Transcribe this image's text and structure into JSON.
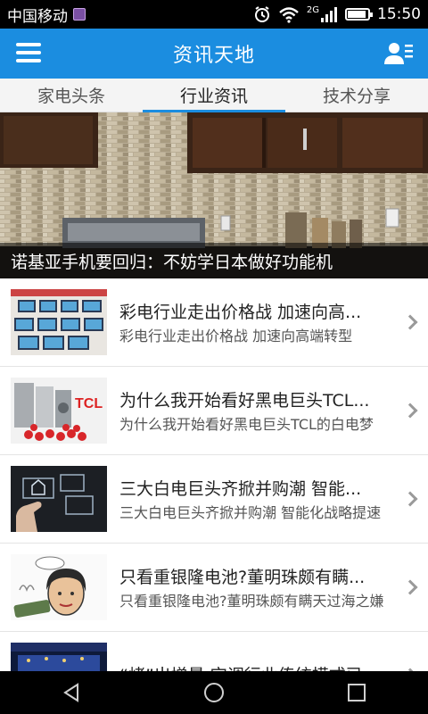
{
  "status_bar": {
    "carrier": "中国移动",
    "network": "2G",
    "time": "15:50",
    "battery_level": 0.9
  },
  "app_bar": {
    "title": "资讯天地",
    "left_icon": "menu-icon",
    "right_icon": "user-list-icon"
  },
  "tabs": [
    {
      "label": "家电头条",
      "active": false
    },
    {
      "label": "行业资讯",
      "active": true
    },
    {
      "label": "技术分享",
      "active": false
    }
  ],
  "banner": {
    "caption": "诺基亚手机要回归：不妨学日本做好功能机"
  },
  "news": [
    {
      "headline": "彩电行业走出价格战 加速向高...",
      "summary": "彩电行业走出价格战 加速向高端转型"
    },
    {
      "headline": "为什么我开始看好黑电巨头TCL...",
      "summary": "为什么我开始看好黑电巨头TCL的白电梦"
    },
    {
      "headline": "三大白电巨头齐掀并购潮 智能...",
      "summary": "三大白电巨头齐掀并购潮 智能化战略提速"
    },
    {
      "headline": "只看重银隆电池?董明珠颇有瞒...",
      "summary": "只看重银隆电池?董明珠颇有瞒天过海之嫌"
    },
    {
      "headline": "“烤”出增量 空调行业传统模式已...",
      "summary": ""
    }
  ],
  "thumb_labels": {
    "tcl": "TCL"
  },
  "colors": {
    "accent": "#1b8de0",
    "status_bar": "#000000"
  }
}
